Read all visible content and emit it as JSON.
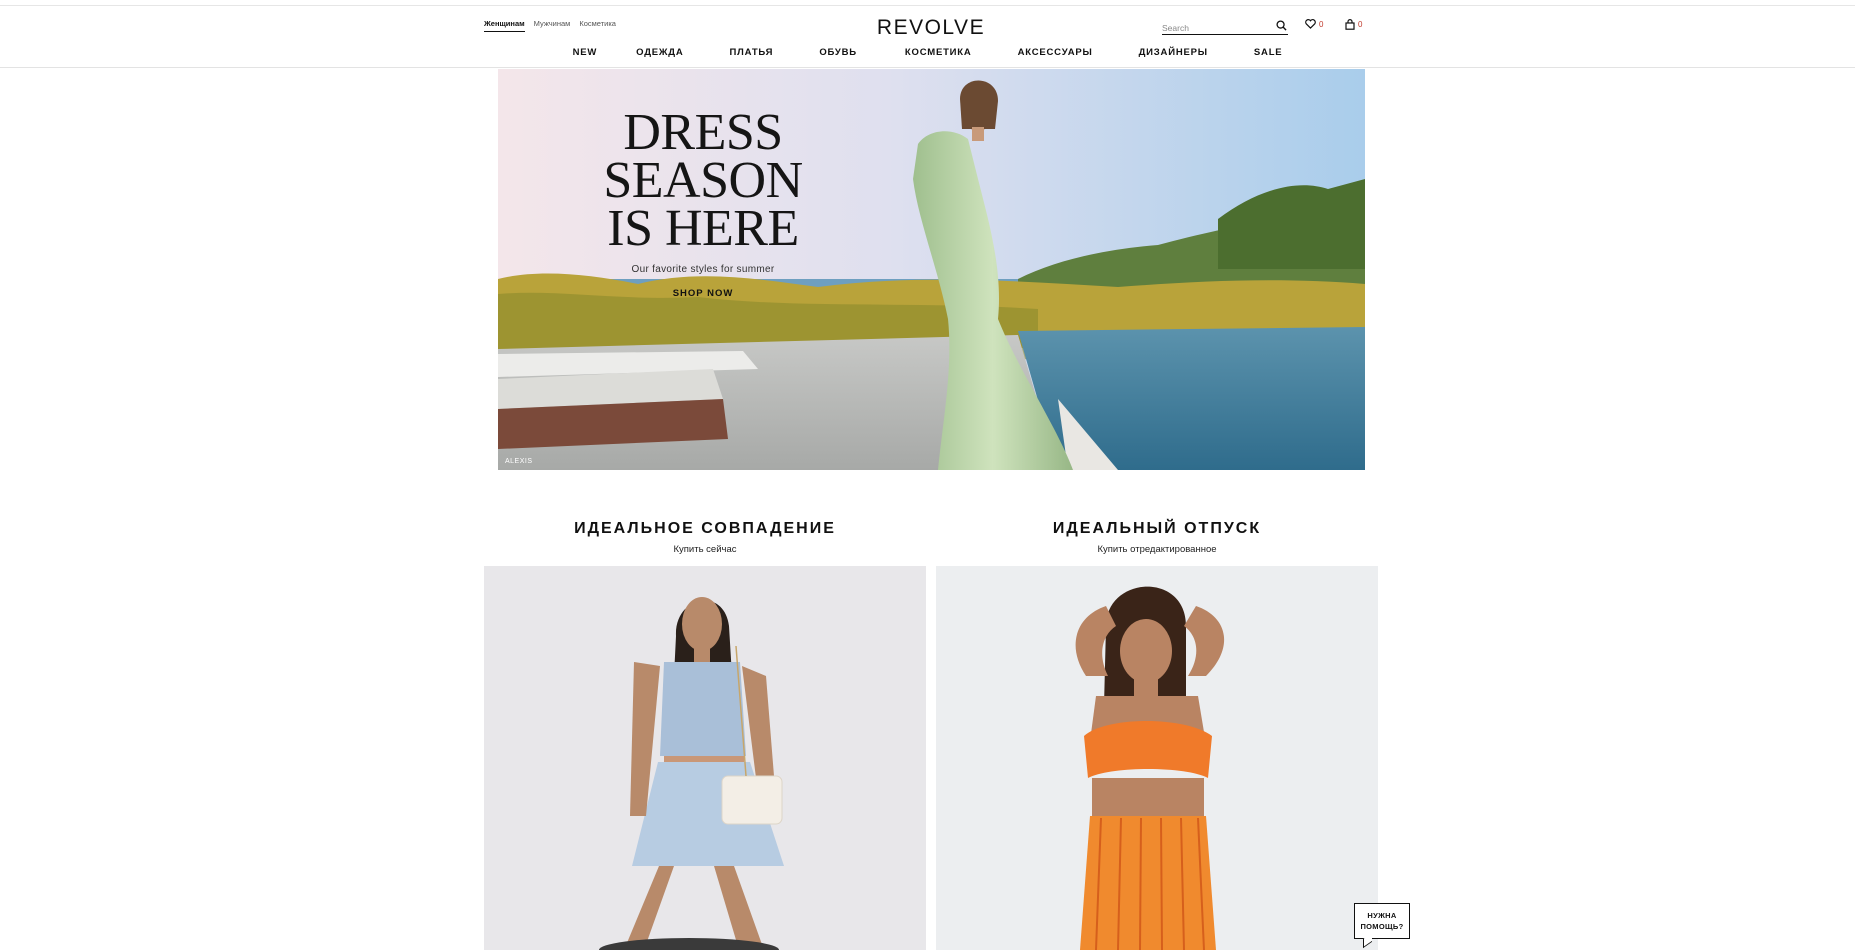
{
  "header": {
    "gender_tabs": [
      "Женщинам",
      "Мужчинам",
      "Косметика"
    ],
    "logo": "REVOLVE",
    "search_placeholder": "Search",
    "wishlist_count": "0",
    "bag_count": "0",
    "nav": [
      "NEW",
      "ОДЕЖДА",
      "ПЛАТЬЯ",
      "ОБУВЬ",
      "КОСМЕТИКА",
      "АКСЕССУАРЫ",
      "ДИЗАЙНЕРЫ",
      "SALE"
    ]
  },
  "hero": {
    "title": "DRESS SEASON\nIS HERE",
    "subtitle": "Our favorite styles for summer",
    "cta": "SHOP NOW",
    "credit": "ALEXIS"
  },
  "promos": [
    {
      "title": "ИДЕАЛЬНОЕ СОВПАДЕНИЕ",
      "link": "Купить сейчас"
    },
    {
      "title": "ИДЕАЛЬНЫЙ ОТПУСК",
      "link": "Купить отредактированное"
    }
  ],
  "help": {
    "label": "НУЖНА ПОМОЩЬ?"
  },
  "colors": {
    "accent": "#c0392b",
    "text": "#111111",
    "divider": "#e3e3e3"
  }
}
